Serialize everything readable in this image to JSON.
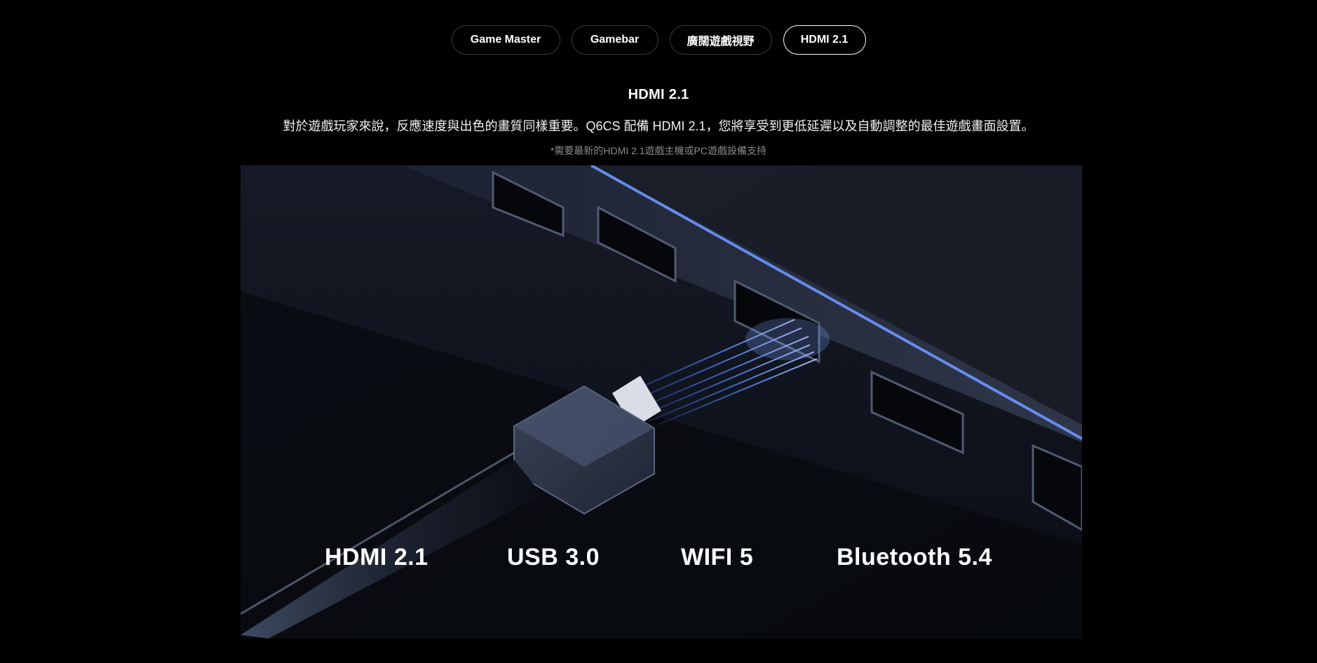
{
  "tabs": [
    {
      "label": "Game Master",
      "active": false
    },
    {
      "label": "Gamebar",
      "active": false
    },
    {
      "label": "廣闊遊戲視野",
      "active": false
    },
    {
      "label": "HDMI 2.1",
      "active": true
    }
  ],
  "section": {
    "title": "HDMI 2.1",
    "description": "對於遊戲玩家來說，反應速度與出色的畫質同樣重要。Q6CS 配備 HDMI 2.1，您將享受到更低延遲以及自動調整的最佳遊戲畫面設置。",
    "note": "*需要最新的HDMI 2.1遊戲主機或PC遊戲設備支持"
  },
  "hero": {
    "specs": [
      "HDMI 2.1",
      "USB 3.0",
      "WIFI 5",
      "Bluetooth 5.4"
    ],
    "accent_color": "#4d7dff"
  }
}
